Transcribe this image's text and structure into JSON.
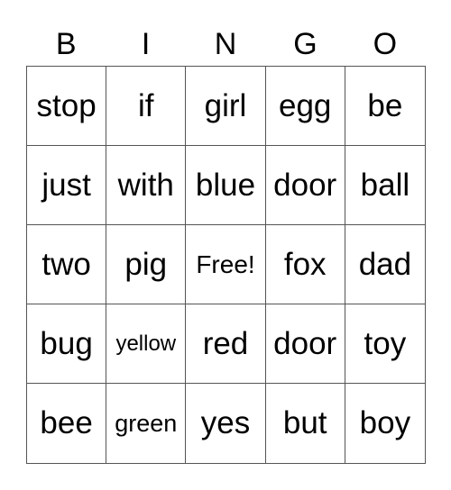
{
  "header": [
    "B",
    "I",
    "N",
    "G",
    "O"
  ],
  "cells": [
    [
      "stop",
      "if",
      "girl",
      "egg",
      "be"
    ],
    [
      "just",
      "with",
      "blue",
      "door",
      "ball"
    ],
    [
      "two",
      "pig",
      "Free!",
      "fox",
      "dad"
    ],
    [
      "bug",
      "yellow",
      "red",
      "door",
      "toy"
    ],
    [
      "bee",
      "green",
      "yes",
      "but",
      "boy"
    ]
  ]
}
